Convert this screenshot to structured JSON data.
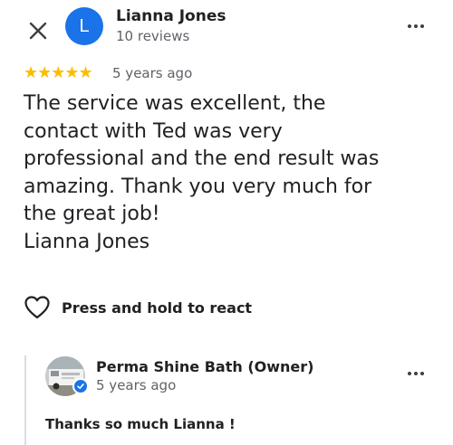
{
  "header": {
    "avatar_letter": "L",
    "reviewer_name": "Lianna Jones",
    "review_count": "10 reviews"
  },
  "review": {
    "rating": 5,
    "stars_text": "★★★★★",
    "time": "5 years ago",
    "text": "The service was excellent, the\ncontact with Ted was very\nprofessional and the end result was\namazing. Thank you very much for\nthe great job!\nLianna Jones"
  },
  "react": {
    "label": "Press and hold to react"
  },
  "owner_reply": {
    "name": "Perma Shine Bath (Owner)",
    "time": "5 years ago",
    "text": "Thanks so much Lianna !"
  },
  "colors": {
    "accent": "#1a73e8",
    "star": "#fbbc04",
    "secondary_text": "#5f6368"
  },
  "icons": {
    "close": "close-icon",
    "more": "more-horizontal-icon",
    "heart": "heart-outline-icon",
    "verified": "verified-check-icon"
  }
}
